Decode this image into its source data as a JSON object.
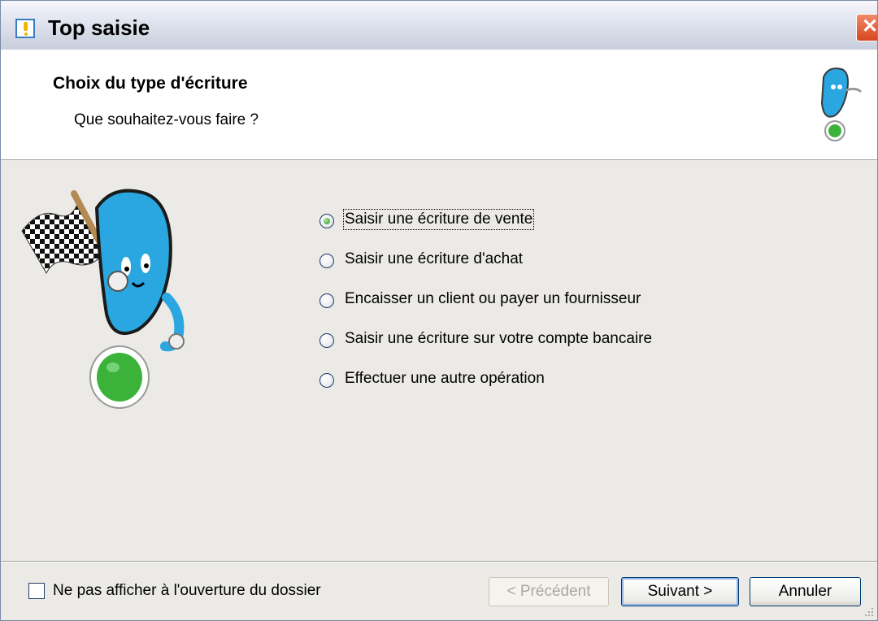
{
  "window": {
    "title": "Top saisie",
    "close_glyph": "✕"
  },
  "header": {
    "title": "Choix du type d'écriture",
    "subtitle": "Que souhaitez-vous faire ?"
  },
  "options": [
    {
      "label": "Saisir une écriture de vente",
      "selected": true
    },
    {
      "label": "Saisir une écriture d'achat",
      "selected": false
    },
    {
      "label": "Encaisser un client ou payer un fournisseur",
      "selected": false
    },
    {
      "label": "Saisir une écriture sur votre compte bancaire",
      "selected": false
    },
    {
      "label": "Effectuer une autre opération",
      "selected": false
    }
  ],
  "footer": {
    "checkbox_label": "Ne pas afficher à l'ouverture du dossier",
    "checkbox_checked": false,
    "prev_label": "< Précédent",
    "next_label": "Suivant >",
    "cancel_label": "Annuler"
  },
  "icons": {
    "app": "app-icon",
    "mascot": "mascot-flag-illustration",
    "mini_mascot": "mini-mascot-icon"
  },
  "colors": {
    "title_bar": "#d6dae6",
    "body": "#ebeae6",
    "header": "#ffffff",
    "radio_dot": "#1e8b1e",
    "mascot_blue": "#2aa6e0",
    "mascot_green": "#3bb33b"
  }
}
